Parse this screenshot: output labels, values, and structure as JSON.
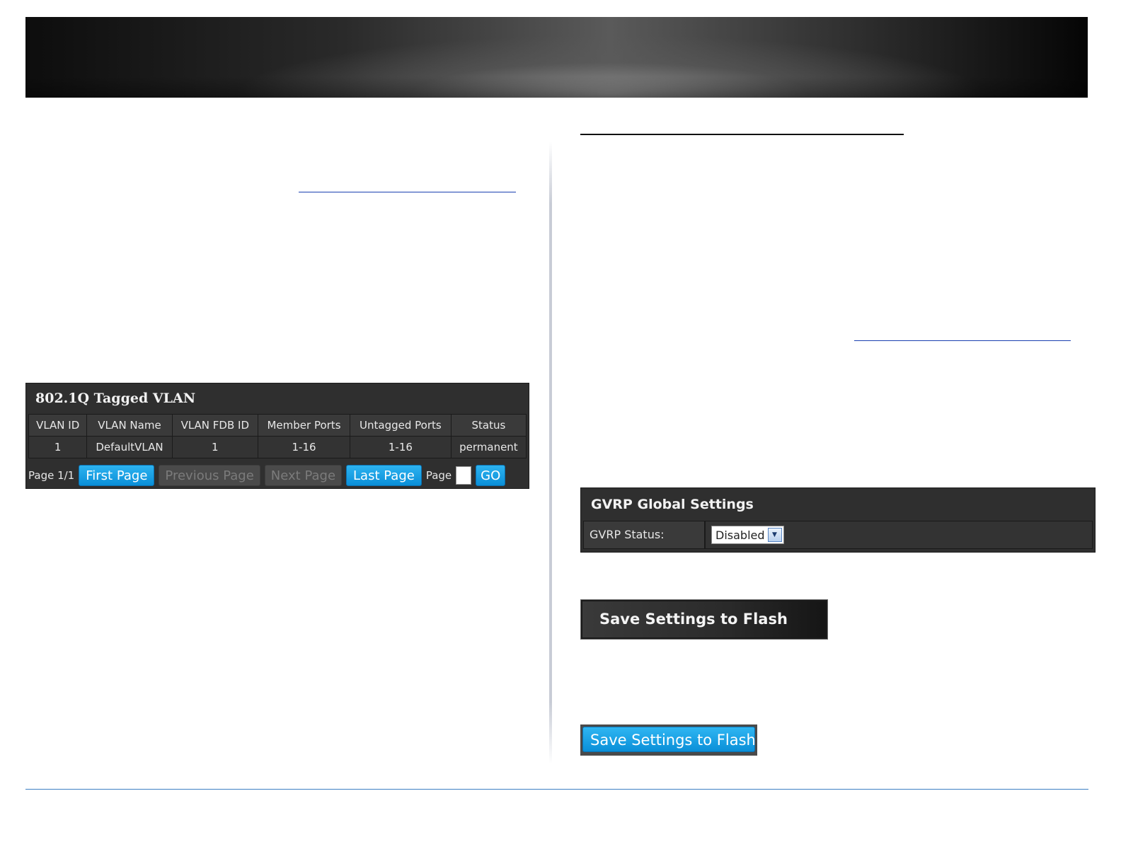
{
  "vlan_panel": {
    "title": "802.1Q Tagged VLAN",
    "columns": [
      "VLAN ID",
      "VLAN Name",
      "VLAN FDB ID",
      "Member Ports",
      "Untagged Ports",
      "Status"
    ],
    "rows": [
      [
        "1",
        "DefaultVLAN",
        "1",
        "1-16",
        "1-16",
        "permanent"
      ]
    ],
    "pager": {
      "page_info": "Page 1/1",
      "first": "First Page",
      "previous": "Previous Page",
      "next": "Next Page",
      "last": "Last Page",
      "page_label": "Page",
      "go": "GO"
    }
  },
  "gvrp_panel": {
    "title": "GVRP Global Settings",
    "status_label": "GVRP Status:",
    "status_value": "Disabled"
  },
  "save_dark": {
    "label": "Save Settings to Flash"
  },
  "save_blue": {
    "label": "Save Settings to Flash"
  }
}
